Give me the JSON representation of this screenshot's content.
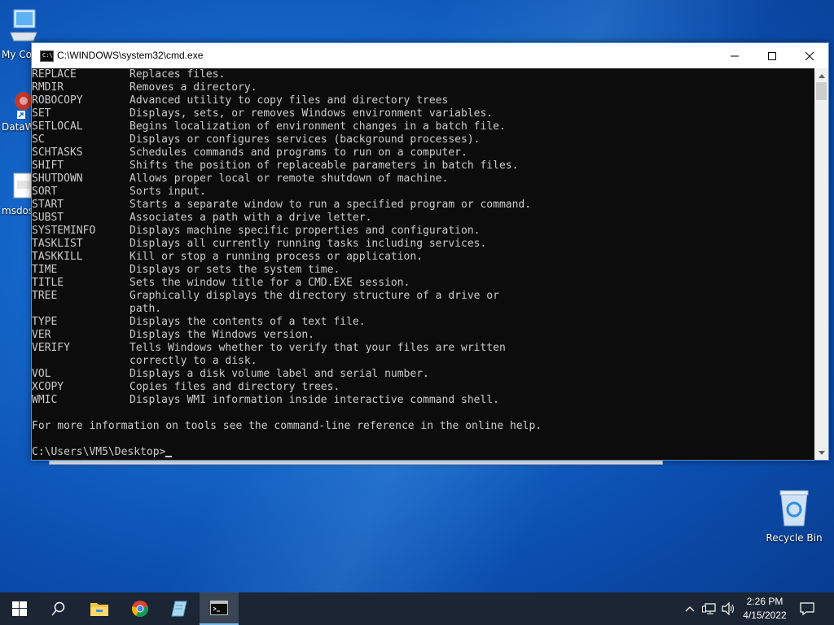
{
  "desktop": {
    "icons": [
      {
        "label": "My Co"
      },
      {
        "label": "DataW"
      },
      {
        "label": "msdos"
      },
      {
        "label": "Recycle Bin"
      }
    ]
  },
  "window": {
    "title": "C:\\WINDOWS\\system32\\cmd.exe",
    "icon_text": "C:\\",
    "controls": {
      "minimize": "minimize-icon",
      "maximize": "maximize-icon",
      "close": "close-icon"
    }
  },
  "console": {
    "commands": [
      {
        "name": "REPLACE",
        "desc": "Replaces files."
      },
      {
        "name": "RMDIR",
        "desc": "Removes a directory."
      },
      {
        "name": "ROBOCOPY",
        "desc": "Advanced utility to copy files and directory trees"
      },
      {
        "name": "SET",
        "desc": "Displays, sets, or removes Windows environment variables."
      },
      {
        "name": "SETLOCAL",
        "desc": "Begins localization of environment changes in a batch file."
      },
      {
        "name": "SC",
        "desc": "Displays or configures services (background processes)."
      },
      {
        "name": "SCHTASKS",
        "desc": "Schedules commands and programs to run on a computer."
      },
      {
        "name": "SHIFT",
        "desc": "Shifts the position of replaceable parameters in batch files."
      },
      {
        "name": "SHUTDOWN",
        "desc": "Allows proper local or remote shutdown of machine."
      },
      {
        "name": "SORT",
        "desc": "Sorts input."
      },
      {
        "name": "START",
        "desc": "Starts a separate window to run a specified program or command."
      },
      {
        "name": "SUBST",
        "desc": "Associates a path with a drive letter."
      },
      {
        "name": "SYSTEMINFO",
        "desc": "Displays machine specific properties and configuration."
      },
      {
        "name": "TASKLIST",
        "desc": "Displays all currently running tasks including services."
      },
      {
        "name": "TASKKILL",
        "desc": "Kill or stop a running process or application."
      },
      {
        "name": "TIME",
        "desc": "Displays or sets the system time."
      },
      {
        "name": "TITLE",
        "desc": "Sets the window title for a CMD.EXE session."
      },
      {
        "name": "TREE",
        "desc": "Graphically displays the directory structure of a drive or"
      },
      {
        "name": "",
        "desc": "path."
      },
      {
        "name": "TYPE",
        "desc": "Displays the contents of a text file."
      },
      {
        "name": "VER",
        "desc": "Displays the Windows version."
      },
      {
        "name": "VERIFY",
        "desc": "Tells Windows whether to verify that your files are written"
      },
      {
        "name": "",
        "desc": "correctly to a disk."
      },
      {
        "name": "VOL",
        "desc": "Displays a disk volume label and serial number."
      },
      {
        "name": "XCOPY",
        "desc": "Copies files and directory trees."
      },
      {
        "name": "WMIC",
        "desc": "Displays WMI information inside interactive command shell."
      }
    ],
    "info": "For more information on tools see the command-line reference in the online help.",
    "prompt": "C:\\Users\\VM5\\Desktop>"
  },
  "taskbar": {
    "buttons": [
      "start-icon",
      "search-icon",
      "file-explorer-icon",
      "chrome-icon",
      "notepad-icon",
      "cmd-icon"
    ],
    "clock_time": "2:26 PM",
    "clock_date": "4/15/2022"
  },
  "colors": {
    "console_bg": "#0c0c0c",
    "console_fg": "#cccccc",
    "taskbar_bg": "#1b2533"
  }
}
